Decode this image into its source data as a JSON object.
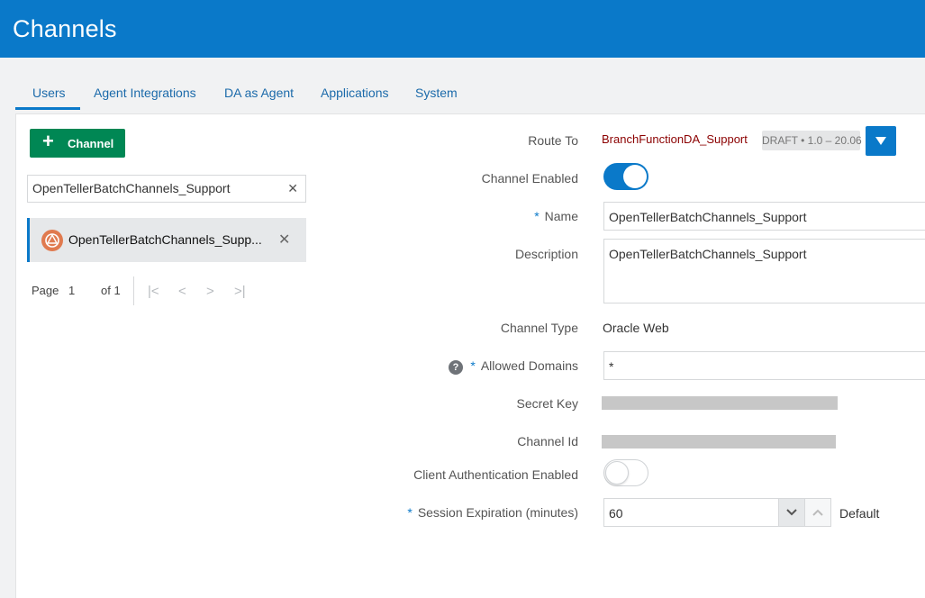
{
  "header": {
    "title": "Channels"
  },
  "tabs": [
    {
      "label": "Users",
      "active": true
    },
    {
      "label": "Agent Integrations",
      "active": false
    },
    {
      "label": "DA as Agent",
      "active": false
    },
    {
      "label": "Applications",
      "active": false
    },
    {
      "label": "System",
      "active": false
    }
  ],
  "sidebar": {
    "add_button_label": "Channel",
    "search_value": "OpenTellerBatchChannels_Support",
    "items": [
      {
        "name": "OpenTellerBatchChannels_Supp..."
      }
    ],
    "pager": {
      "page_label": "Page",
      "page_value": "1",
      "of_label": "of 1"
    }
  },
  "form": {
    "route_to": {
      "label": "Route To",
      "value": "BranchFunctionDA_Support",
      "badge": "DRAFT • 1.0 – 20.06"
    },
    "channel_enabled": {
      "label": "Channel Enabled",
      "on": true
    },
    "name": {
      "label": "Name",
      "required": "*",
      "value": "OpenTellerBatchChannels_Support"
    },
    "description": {
      "label": "Description",
      "value": "OpenTellerBatchChannels_Support"
    },
    "channel_type": {
      "label": "Channel Type",
      "value": "Oracle Web"
    },
    "allowed_domains": {
      "label": "Allowed Domains",
      "required": "*",
      "value": "*",
      "help_icon": "?"
    },
    "secret_key": {
      "label": "Secret Key"
    },
    "channel_id": {
      "label": "Channel Id"
    },
    "client_auth": {
      "label": "Client Authentication Enabled",
      "on": false
    },
    "session_expiration": {
      "label": "Session Expiration (minutes)",
      "required": "*",
      "value": "60",
      "default_label": "Default"
    }
  },
  "colors": {
    "brand": "#0a79c9",
    "add_button": "#008754",
    "route_value": "#8b0000"
  }
}
